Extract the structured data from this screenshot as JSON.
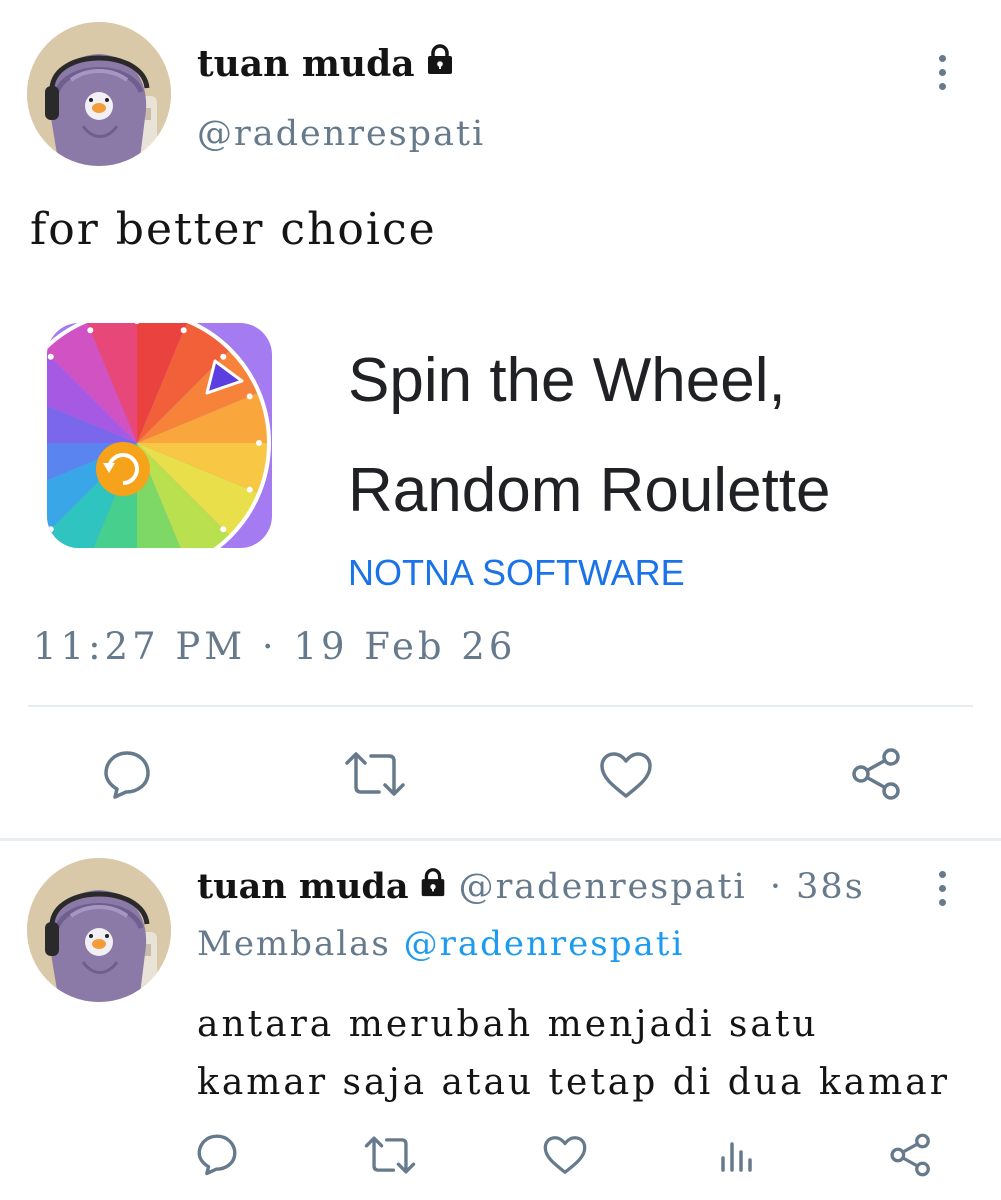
{
  "tweet": {
    "author_name": "tuan muda",
    "author_handle": "@radenrespati",
    "text": "for better choice",
    "card": {
      "title_line1": "Spin the Wheel,",
      "title_line2": "Random Roulette",
      "developer": "NOTNA SOFTWARE"
    },
    "time": "11:27 PM",
    "date": "19 Feb 26",
    "actions": [
      "reply-icon",
      "retweet-icon",
      "like-icon",
      "share-icon"
    ]
  },
  "reply": {
    "author_name": "tuan muda",
    "author_handle": "@radenrespati",
    "age": "38s",
    "replying_prefix": "Membalas",
    "replying_to": "@radenrespati",
    "text": "antara merubah menjadi satu kamar saja atau tetap di dua kamar",
    "actions": [
      "reply-icon",
      "retweet-icon",
      "like-icon",
      "analytics-icon",
      "share-icon"
    ]
  },
  "colors": {
    "secondary_text": "#667a8c",
    "link": "#1d9bf0",
    "app_developer": "#1a73e8",
    "app_icon_bg": "#a47bf0"
  }
}
